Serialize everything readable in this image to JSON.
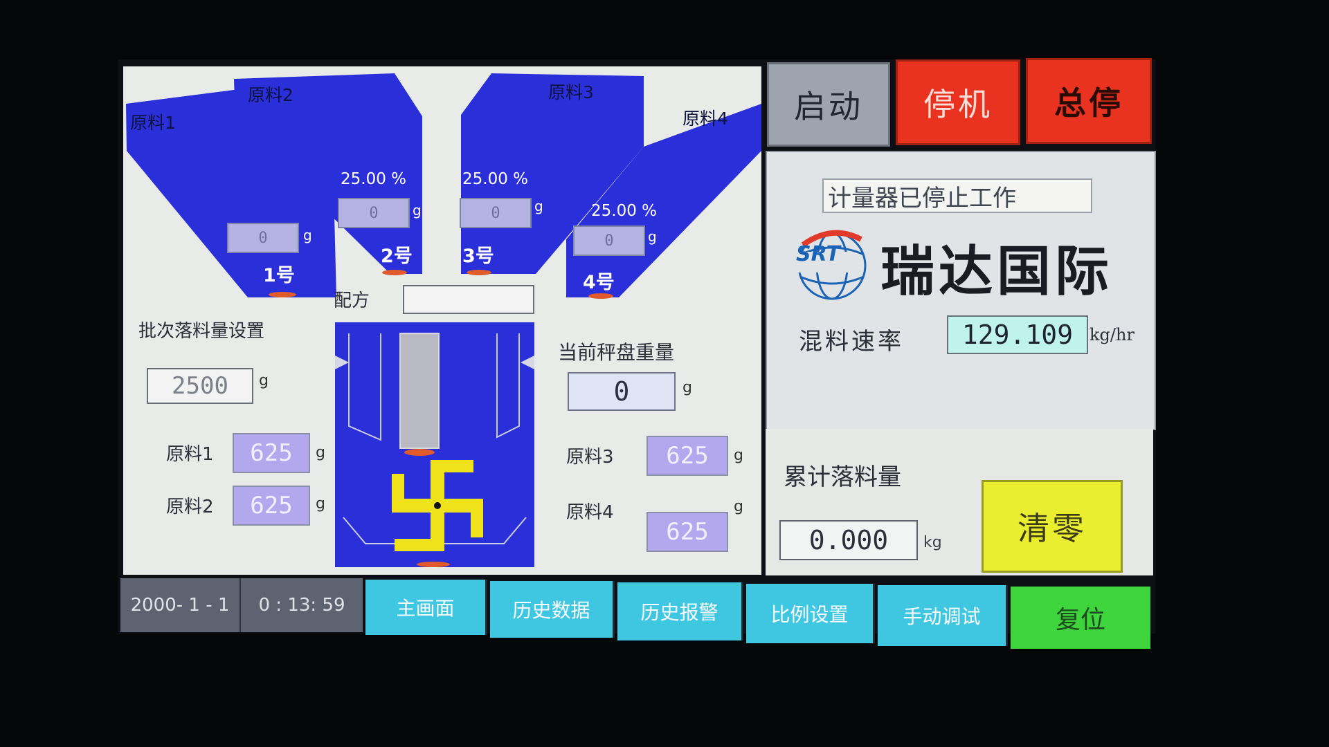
{
  "hoppers": {
    "material1_label": "原料1",
    "material2_label": "原料2",
    "material3_label": "原料3",
    "material4_label": "原料4",
    "h1": {
      "number": "1号",
      "weight": "0",
      "unit": "g"
    },
    "h2": {
      "number": "2号",
      "weight": "0",
      "unit": "g",
      "percent": "25.00 %"
    },
    "h3": {
      "number": "3号",
      "weight": "0",
      "unit": "g",
      "percent": "25.00 %"
    },
    "h4": {
      "number": "4号",
      "weight": "0",
      "unit": "g",
      "percent": "25.00 %"
    }
  },
  "recipe": {
    "label": "配方",
    "value": ""
  },
  "batch": {
    "label": "批次落料量设置",
    "value": "2500",
    "unit": "g"
  },
  "materials": [
    {
      "label": "原料1",
      "value": "625",
      "unit": "g"
    },
    {
      "label": "原料2",
      "value": "625",
      "unit": "g"
    },
    {
      "label": "原料3",
      "value": "625",
      "unit": "g"
    },
    {
      "label": "原料4",
      "value": "625",
      "unit": "g"
    }
  ],
  "scale": {
    "label": "当前秤盘重量",
    "value": "0",
    "unit": "g"
  },
  "controls": {
    "start": "启动",
    "stop": "停机",
    "emergency_stop": "总停"
  },
  "status": {
    "text": "计量器已停止工作"
  },
  "brand": {
    "logo_text": "SRT",
    "name": "瑞达国际"
  },
  "rate": {
    "label": "混料速率",
    "value": "129.109",
    "unit": "kg/hr"
  },
  "total": {
    "label": "累计落料量",
    "value": "0.000",
    "unit": "kg"
  },
  "clear_label": "清零",
  "footer": {
    "date": "2000- 1 - 1",
    "time": "0 : 13: 59",
    "nav": [
      "主画面",
      "历史数据",
      "历史报警",
      "比例设置",
      "手动调试",
      "复位"
    ]
  },
  "colors": {
    "hopper_blue": "#2b2fd9",
    "start_gray": "#9ea4ae",
    "stop_red": "#e9321f",
    "clear_yellow": "#e9ee30",
    "nav_cyan": "#3fc7e2",
    "reset_green": "#3ed43c",
    "mixer_yellow": "#f0e21a"
  }
}
